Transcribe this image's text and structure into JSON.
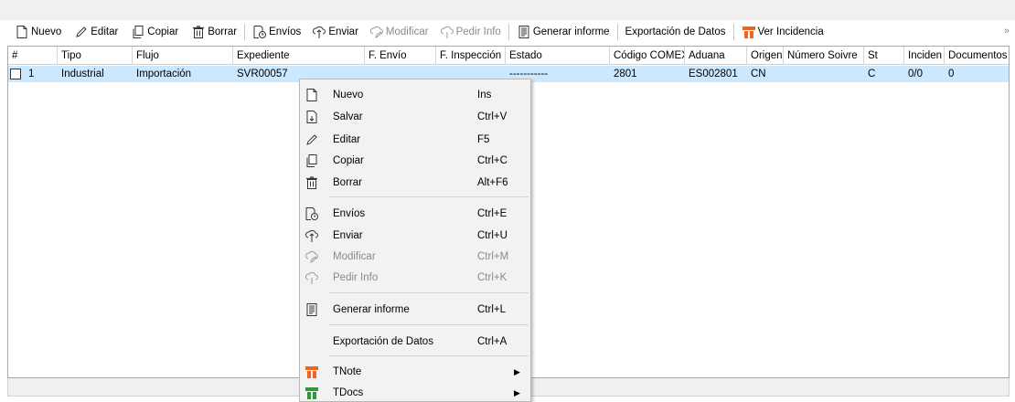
{
  "toolbar": {
    "nuevo": "Nuevo",
    "editar": "Editar",
    "copiar": "Copiar",
    "borrar": "Borrar",
    "envios": "Envíos",
    "enviar": "Enviar",
    "modificar": "Modificar",
    "pedir_info": "Pedir Info",
    "generar_informe": "Generar informe",
    "exportacion": "Exportación de Datos",
    "ver_incidencia": "Ver Incidencia",
    "more": "»"
  },
  "grid": {
    "columns": [
      "#",
      "Tipo",
      "Flujo",
      "Expediente",
      "F. Envío",
      "F. Inspección",
      "Estado",
      "Código COMEX",
      "Aduana",
      "Origen",
      "Número Soivre",
      "St",
      "Inciden",
      "Documentos"
    ],
    "rows": [
      {
        "num": "1",
        "tipo": "Industrial",
        "flujo": "Importación",
        "expediente": "SVR00057",
        "f_envio": "",
        "f_inspeccion": "",
        "estado": "-----------",
        "codigo_comex": "2801",
        "aduana": "ES002801",
        "origen": "CN",
        "numero_soivre": "",
        "st": "C",
        "inciden": "0/0",
        "documentos": "0"
      }
    ]
  },
  "context_menu": {
    "items": [
      {
        "label": "Nuevo",
        "shortcut": "Ins",
        "icon": "new-document-icon"
      },
      {
        "label": "Salvar",
        "shortcut": "Ctrl+V",
        "icon": "save-icon"
      },
      {
        "label": "Editar",
        "shortcut": "F5",
        "icon": "pencil-icon"
      },
      {
        "label": "Copiar",
        "shortcut": "Ctrl+C",
        "icon": "copy-icon"
      },
      {
        "label": "Borrar",
        "shortcut": "Alt+F6",
        "icon": "trash-icon"
      },
      {
        "label": "Envíos",
        "shortcut": "Ctrl+E",
        "icon": "shipments-icon"
      },
      {
        "label": "Enviar",
        "shortcut": "Ctrl+U",
        "icon": "cloud-upload-icon"
      },
      {
        "label": "Modificar",
        "shortcut": "Ctrl+M",
        "icon": "cloud-edit-icon",
        "disabled": true
      },
      {
        "label": "Pedir Info",
        "shortcut": "Ctrl+K",
        "icon": "cloud-request-icon",
        "disabled": true
      },
      {
        "label": "Generar informe",
        "shortcut": "Ctrl+L",
        "icon": "report-icon"
      },
      {
        "label": "Exportación de Datos",
        "shortcut": "Ctrl+A",
        "icon": ""
      },
      {
        "label": "TNote",
        "shortcut": "",
        "icon": "tnote-icon",
        "submenu": true
      },
      {
        "label": "TDocs",
        "shortcut": "",
        "icon": "tdocs-icon",
        "submenu": true
      }
    ]
  },
  "colors": {
    "selection": "#cce8ff",
    "tnote_orange": "#f0641e",
    "tdocs_green": "#2e9b3a"
  }
}
